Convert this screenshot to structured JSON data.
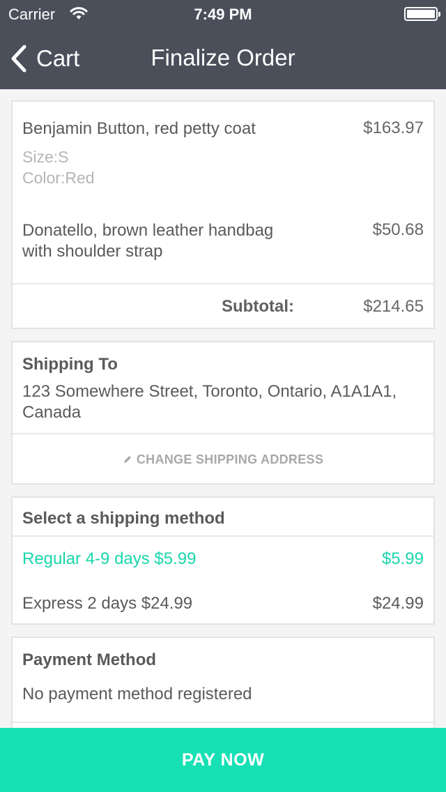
{
  "status_bar": {
    "carrier": "Carrier",
    "time": "7:49 PM"
  },
  "nav": {
    "back_label": "Cart",
    "title": "Finalize Order"
  },
  "order": {
    "items": [
      {
        "name": "Benjamin Button, red petty coat",
        "price": "$163.97",
        "size": "Size:S",
        "color": "Color:Red"
      },
      {
        "name_line1": "Donatello, brown leather handbag",
        "name_line2": "with shoulder strap",
        "price": "$50.68"
      }
    ],
    "subtotal_label": "Subtotal:",
    "subtotal_value": "$214.65"
  },
  "shipping": {
    "title": "Shipping To",
    "address_line1": "123 Somewhere Street, Toronto, Ontario, A1A1A1,",
    "address_line2": "Canada",
    "change_label": "CHANGE SHIPPING ADDRESS"
  },
  "shipping_method": {
    "title": "Select a shipping method",
    "options": [
      {
        "name": "Regular 4-9 days $5.99",
        "price": "$5.99",
        "selected": true
      },
      {
        "name": "Express 2 days $24.99",
        "price": "$24.99",
        "selected": false
      }
    ]
  },
  "payment": {
    "title": "Payment Method",
    "status": "No payment method registered"
  },
  "pay_button": "PAY NOW",
  "colors": {
    "nav_bg": "#4a4f5a",
    "accent": "#17e0b4",
    "selected_text": "#1ad6ad"
  }
}
